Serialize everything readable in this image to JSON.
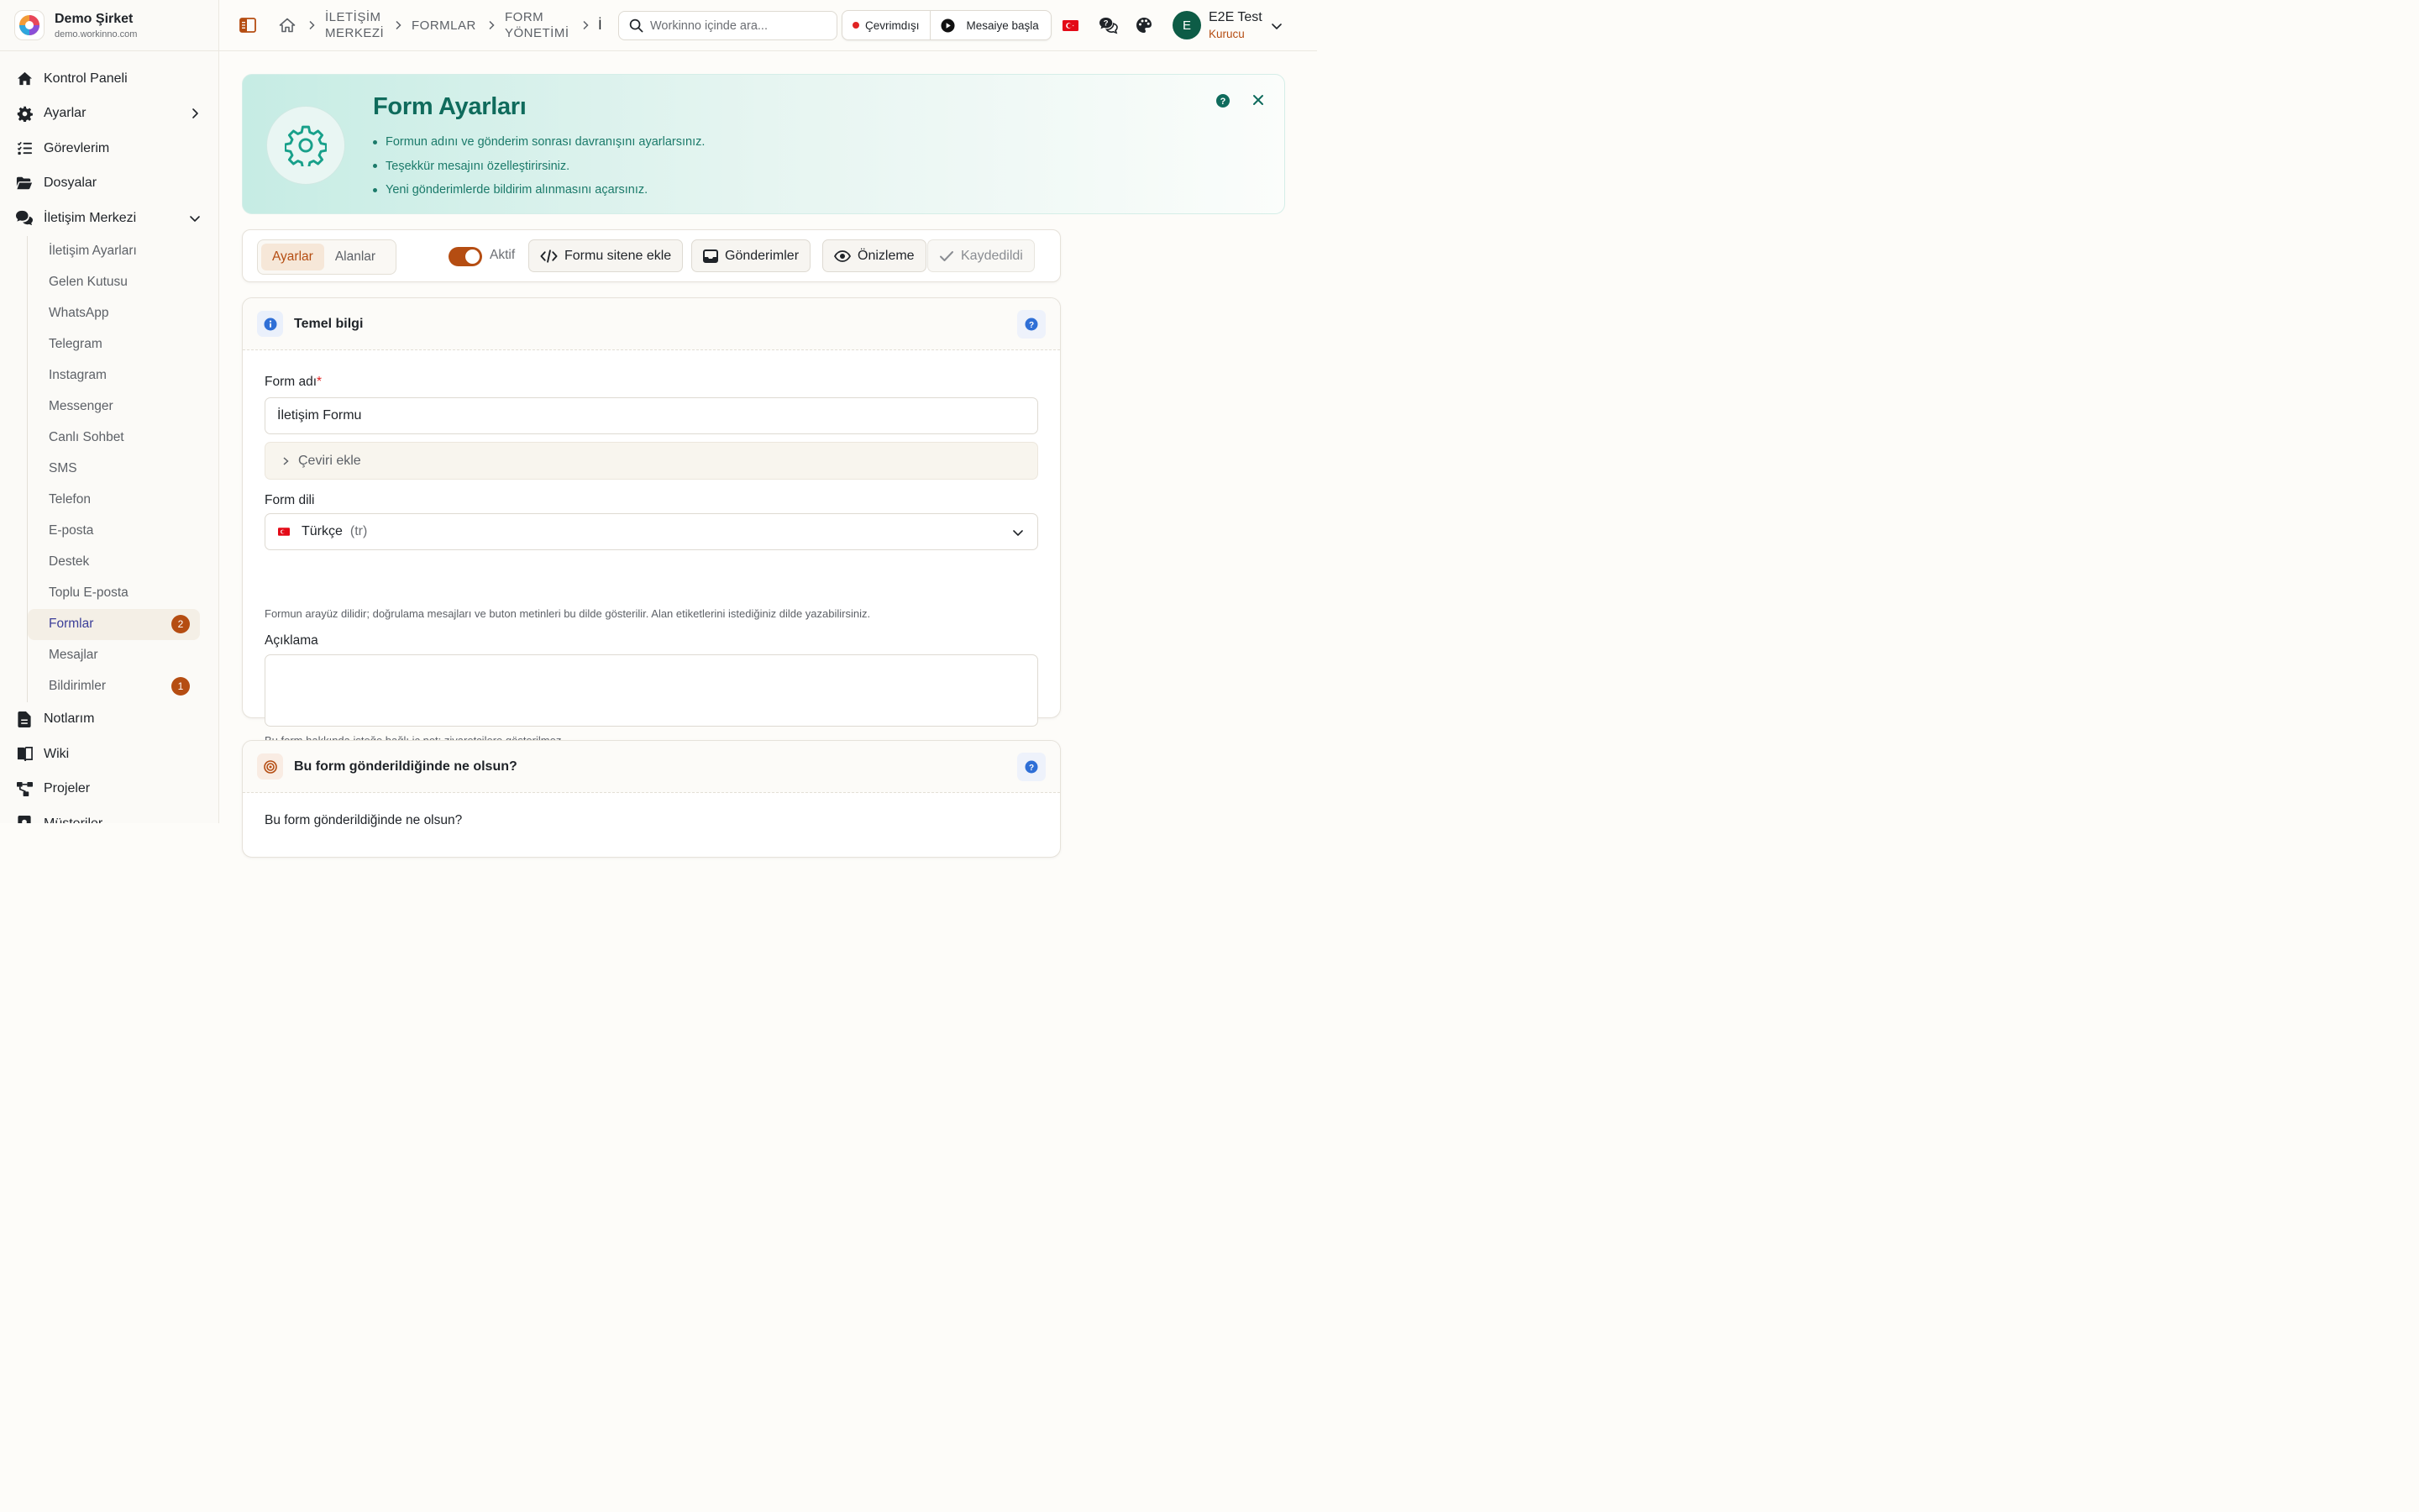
{
  "brand": {
    "name": "Demo Şirket",
    "domain": "demo.workinno.com"
  },
  "sidebar": {
    "items": [
      {
        "label": "Kontrol Paneli"
      },
      {
        "label": "Ayarlar"
      },
      {
        "label": "Görevlerim"
      },
      {
        "label": "Dosyalar"
      },
      {
        "label": "İletişim Merkezi"
      }
    ],
    "sub_items": [
      {
        "label": "İletişim Ayarları"
      },
      {
        "label": "Gelen Kutusu"
      },
      {
        "label": "WhatsApp"
      },
      {
        "label": "Telegram"
      },
      {
        "label": "Instagram"
      },
      {
        "label": "Messenger"
      },
      {
        "label": "Canlı Sohbet"
      },
      {
        "label": "SMS"
      },
      {
        "label": "Telefon"
      },
      {
        "label": "E-posta"
      },
      {
        "label": "Destek"
      },
      {
        "label": "Toplu E-posta"
      },
      {
        "label": "Formlar",
        "badge": "2"
      },
      {
        "label": "Mesajlar"
      },
      {
        "label": "Bildirimler",
        "badge": "1"
      }
    ],
    "bottom_items": [
      {
        "label": "Notlarım"
      },
      {
        "label": "Wiki"
      },
      {
        "label": "Projeler"
      },
      {
        "label": "Müşteriler"
      }
    ]
  },
  "breadcrumb": {
    "c1_line1": "İLETİŞİM",
    "c1_line2": "MERKEZİ",
    "c2": "FORMLAR",
    "c3_line1": "FORM",
    "c3_line2": "YÖNETİMİ",
    "c4": "İ"
  },
  "search": {
    "placeholder": "Workinno içinde ara..."
  },
  "status": {
    "offline": "Çevrimdışı",
    "start_shift": "Mesaiye başla"
  },
  "user": {
    "initial": "E",
    "name": "E2E Test",
    "role": "Kurucu"
  },
  "hero": {
    "title": "Form Ayarları",
    "bullets": [
      "Formun adını ve gönderim sonrası davranışını ayarlarsınız.",
      "Teşekkür mesajını özelleştirirsiniz.",
      "Yeni gönderimlerde bildirim alınmasını açarsınız."
    ]
  },
  "toolbar": {
    "tab_settings": "Ayarlar",
    "tab_fields": "Alanlar",
    "active_label": "Aktif",
    "embed": "Formu sitene ekle",
    "submissions": "Gönderimler",
    "preview": "Önizleme",
    "saved": "Kaydedildi"
  },
  "basic": {
    "title": "Temel bilgi",
    "form_name_label": "Form adı",
    "required_mark": "*",
    "form_name_value": "İletişim Formu",
    "add_translation": "Çeviri ekle",
    "language_label": "Form dili",
    "language_value": "Türkçe",
    "language_code": "(tr)",
    "language_hint": "Formun arayüz dilidir; doğrulama mesajları ve buton metinleri bu dilde gösterilir. Alan etiketlerini istediğiniz dilde yazabilirsiniz.",
    "description_label": "Açıklama",
    "description_hint": "Bu form hakkında isteğe bağlı iç not; ziyaretçilere gösterilmez."
  },
  "after_submit": {
    "title": "Bu form gönderildiğinde ne olsun?",
    "field_label": "Bu form gönderildiğinde ne olsun?"
  },
  "colors": {
    "accent": "#b54d12",
    "teal": "#0f6b5c",
    "active_nav": "#3c3f99"
  }
}
